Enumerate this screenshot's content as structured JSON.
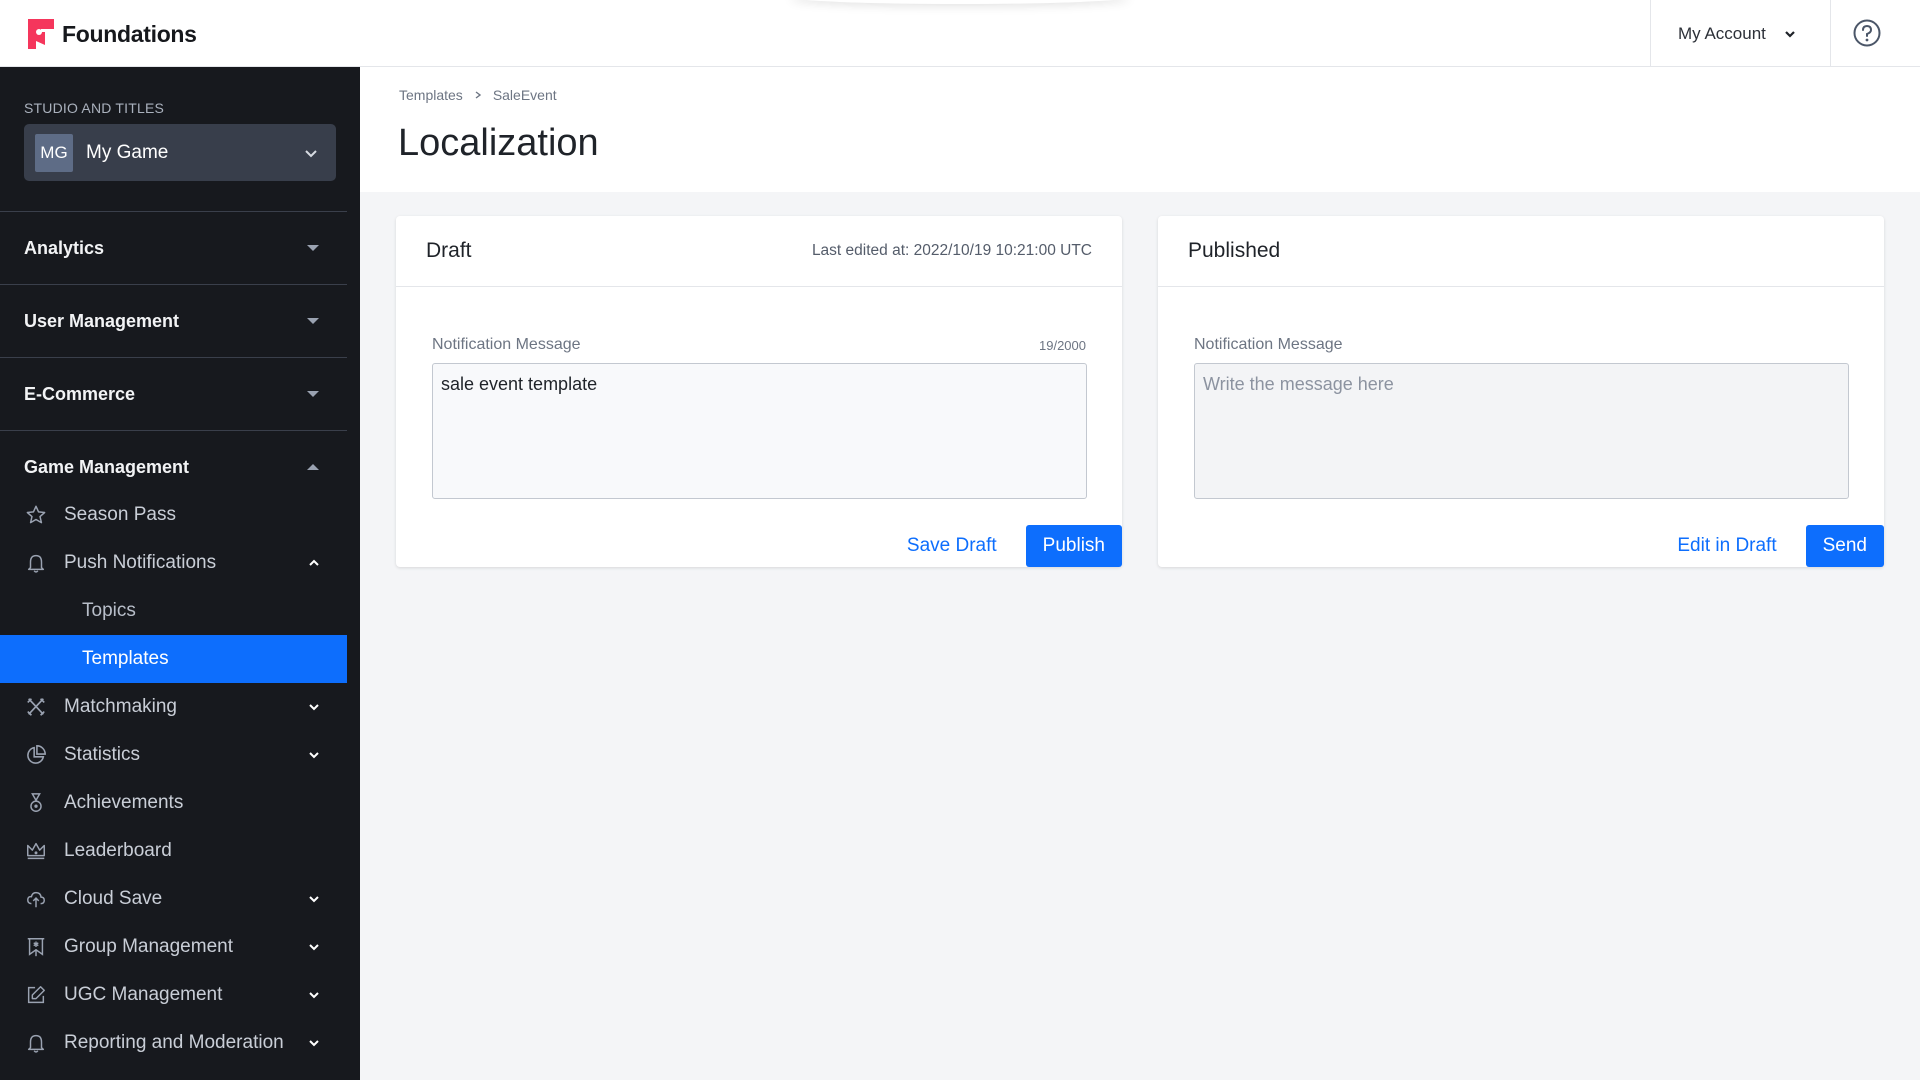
{
  "app": {
    "brand": "Foundations",
    "brand_color": "#f5365c",
    "accent_color": "#0d6efd"
  },
  "header": {
    "account_label": "My Account",
    "help_icon": "help-circle-icon"
  },
  "sidebar": {
    "studio_label": "STUDIO AND TITLES",
    "studio": {
      "badge": "MG",
      "name": "My Game"
    },
    "sections": [
      {
        "label": "Analytics",
        "expanded": false
      },
      {
        "label": "User Management",
        "expanded": false
      },
      {
        "label": "E-Commerce",
        "expanded": false
      },
      {
        "label": "Game Management",
        "expanded": true
      }
    ],
    "items": [
      {
        "label": "Season Pass",
        "icon": "star-icon"
      },
      {
        "label": "Push Notifications",
        "icon": "bell-icon",
        "expanded": true
      },
      {
        "label": "Matchmaking",
        "icon": "crossed-swords-icon"
      },
      {
        "label": "Statistics",
        "icon": "pie-chart-icon"
      },
      {
        "label": "Achievements",
        "icon": "medal-icon"
      },
      {
        "label": "Leaderboard",
        "icon": "crown-icon"
      },
      {
        "label": "Cloud Save",
        "icon": "cloud-upload-icon"
      },
      {
        "label": "Group Management",
        "icon": "banner-icon"
      },
      {
        "label": "UGC Management",
        "icon": "edit-icon"
      },
      {
        "label": "Reporting and Moderation",
        "icon": "bell-icon"
      }
    ],
    "sub_items": [
      {
        "label": "Topics",
        "active": false
      },
      {
        "label": "Templates",
        "active": true
      }
    ]
  },
  "main": {
    "breadcrumb": [
      "Templates",
      "SaleEvent"
    ],
    "title": "Localization",
    "draft": {
      "title": "Draft",
      "last_edited": "Last edited at: 2022/10/19 10:21:00 UTC",
      "field_label": "Notification Message",
      "counter": "19/2000",
      "value": "sale event template",
      "save_label": "Save Draft",
      "publish_label": "Publish"
    },
    "published": {
      "title": "Published",
      "field_label": "Notification Message",
      "placeholder": "Write the message here",
      "value": "",
      "edit_label": "Edit in Draft",
      "send_label": "Send"
    }
  }
}
